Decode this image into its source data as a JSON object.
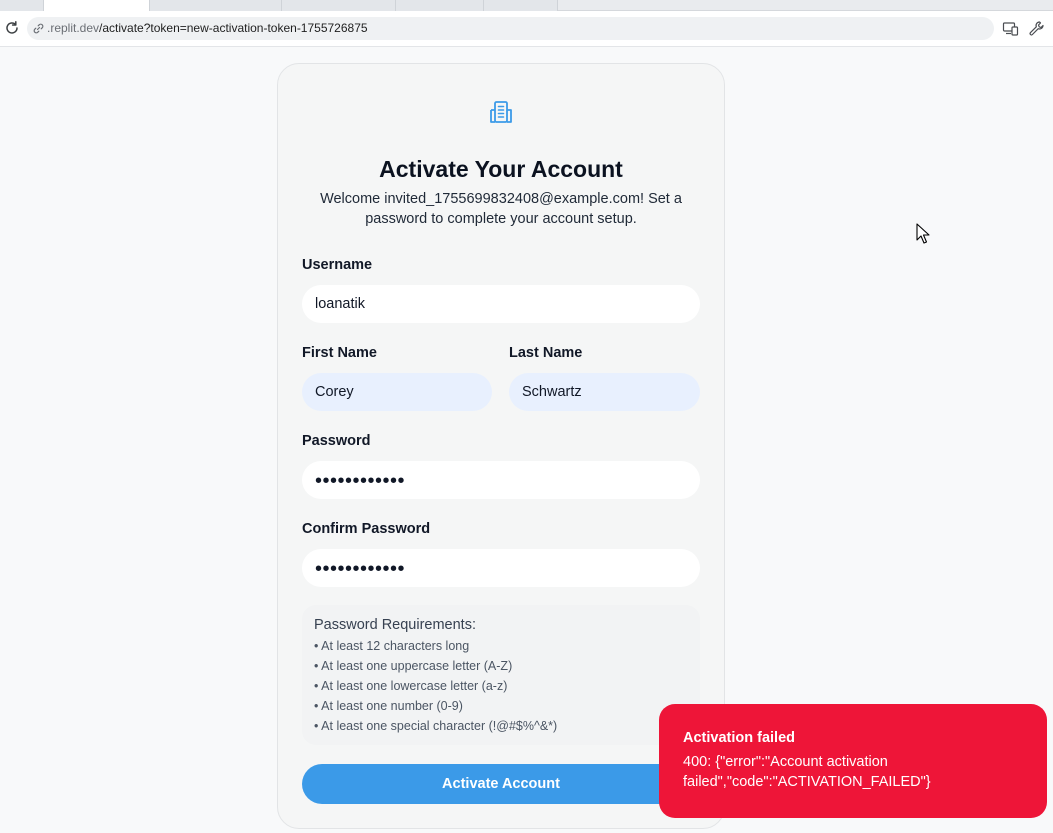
{
  "browser": {
    "url_host": ".replit.dev",
    "url_path": "/activate?token=new-activation-token-1755726875"
  },
  "card": {
    "title": "Activate Your Account",
    "subtitle": "Welcome invited_1755699832408@example.com! Set a password to complete your account setup."
  },
  "form": {
    "username_label": "Username",
    "username_value": "loanatik",
    "first_name_label": "First Name",
    "first_name_value": "Corey",
    "last_name_label": "Last Name",
    "last_name_value": "Schwartz",
    "password_label": "Password",
    "password_value": "••••••••••••",
    "confirm_label": "Confirm Password",
    "confirm_value": "••••••••••••",
    "submit_label": "Activate Account"
  },
  "requirements": {
    "title": "Password Requirements:",
    "items": [
      "At least 12 characters long",
      "At least one uppercase letter (A-Z)",
      "At least one lowercase letter (a-z)",
      "At least one number (0-9)",
      "At least one special character (!@#$%^&*)"
    ]
  },
  "toast": {
    "title": "Activation failed",
    "message": "400: {\"error\":\"Account activation failed\",\"code\":\"ACTIVATION_FAILED\"}"
  },
  "colors": {
    "accent": "#3b9ae8",
    "toast_bg": "#ee1538",
    "autofill_bg": "#e8f0fe"
  },
  "icons": {
    "reload": "reload-icon",
    "link": "link-icon",
    "devices": "devices-icon",
    "wrench": "wrench-icon",
    "building": "building-icon",
    "cursor": "cursor-icon"
  }
}
